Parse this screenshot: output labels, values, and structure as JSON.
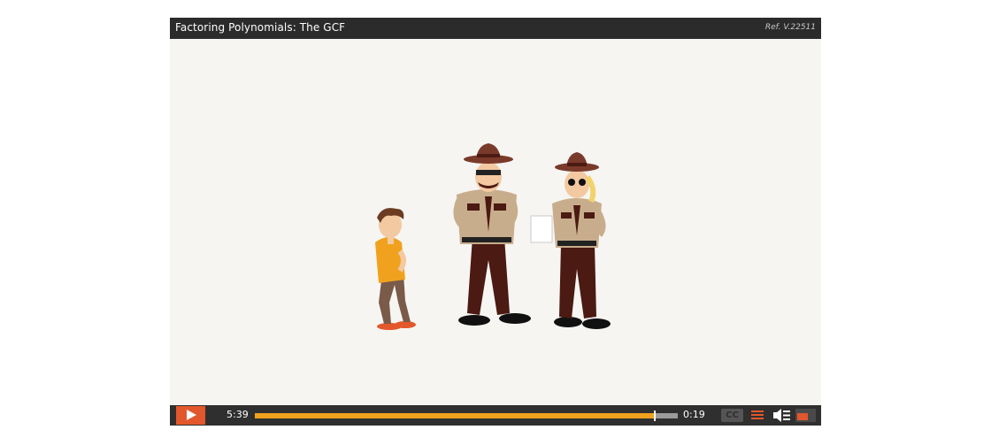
{
  "player": {
    "title": "Factoring Polynomials: The GCF",
    "ref": "Ref. V.22511"
  },
  "controls": {
    "elapsed": "5:39",
    "remaining": "0:19",
    "progress_fraction": 0.946,
    "cc_label": "CC"
  },
  "colors": {
    "accent": "#e2572b",
    "progress": "#f0a21e",
    "bar": "#2f2f2f",
    "stage": "#f6f5f2"
  },
  "icons": [
    "play-icon",
    "closed-captions-icon",
    "menu-icon",
    "volume-icon",
    "fullscreen-icon"
  ]
}
